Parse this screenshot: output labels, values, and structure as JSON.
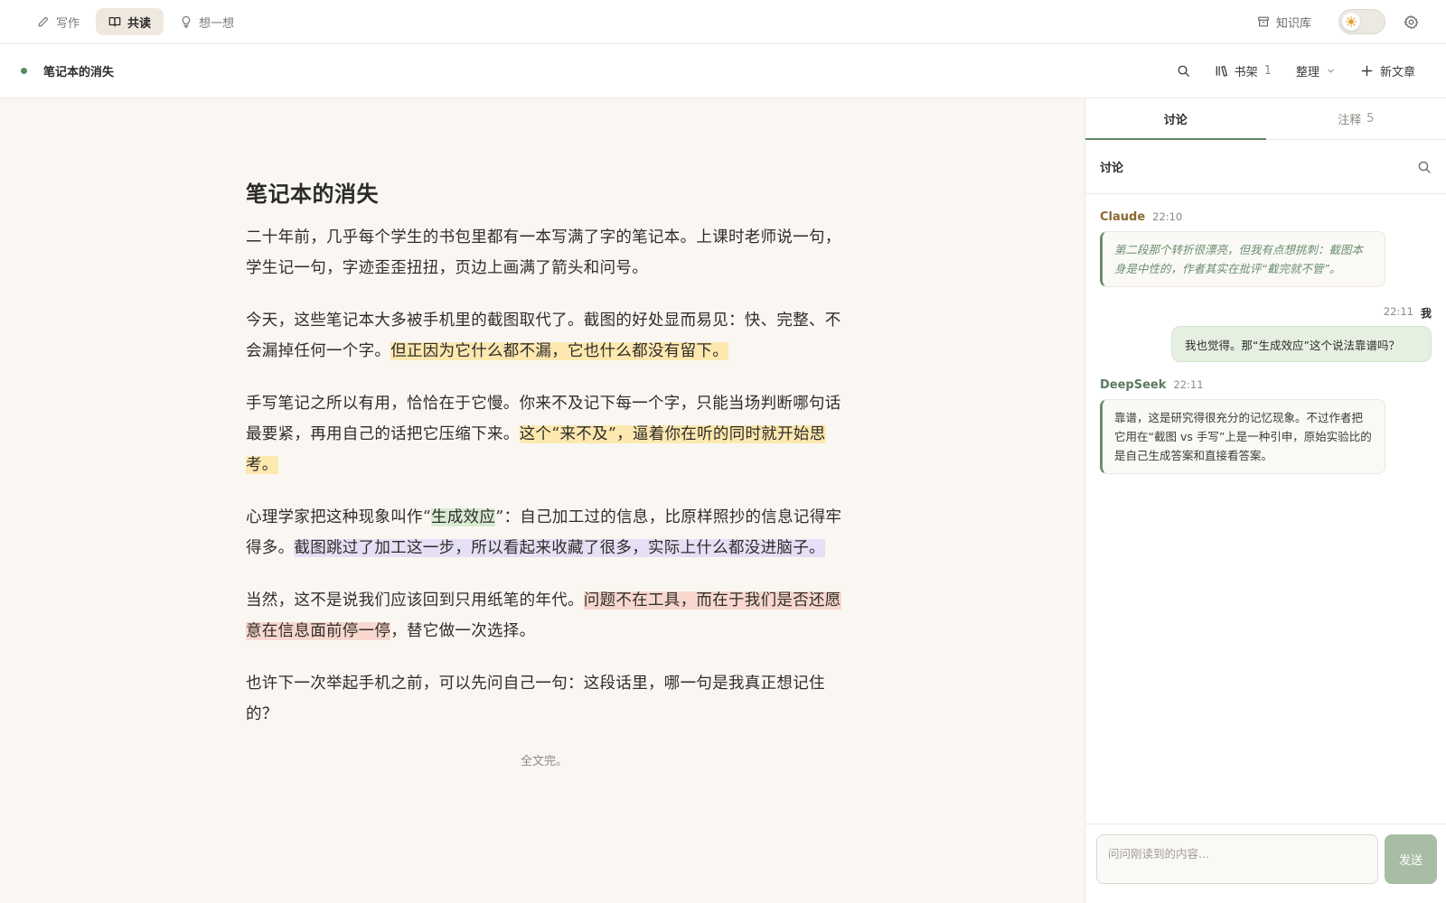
{
  "nav": {
    "modes": [
      {
        "label": "写作",
        "icon": "pencil-icon",
        "active": false
      },
      {
        "label": "共读",
        "icon": "book-open-icon",
        "active": true
      },
      {
        "label": "想一想",
        "icon": "lightbulb-icon",
        "active": false
      }
    ],
    "knowledge_base": "知识库",
    "theme": "light"
  },
  "docbar": {
    "title": "笔记本的消失",
    "bookshelf_label": "书架",
    "bookshelf_count": "1",
    "organize_label": "整理",
    "new_article_label": "新文章"
  },
  "article": {
    "title": "笔记本的消失",
    "p1": "二十年前，几乎每个学生的书包里都有一本写满了字的笔记本。上课时老师说一句，学生记一句，字迹歪歪扭扭，页边上画满了箭头和问号。",
    "p2_a": "今天，这些笔记本大多被手机里的截图取代了。截图的好处显而易见：快、完整、不会漏掉任何一个字。",
    "p2_hl": "但正因为它什么都不漏，它也什么都没有留下。",
    "p3_a": "手写笔记之所以有用，恰恰在于它慢。你来不及记下每一个字，只能当场判断哪句话最要紧，再用自己的话把它压缩下来。",
    "p3_hl": "这个“来不及”，逼着你在听的同时就开始思考。",
    "p4_a": "心理学家把这种现象叫作“",
    "p4_hl1": "生成效应",
    "p4_b": "”：自己加工过的信息，比原样照抄的信息记得牢得多。",
    "p4_hl2": "截图跳过了加工这一步，所以看起来收藏了很多，实际上什么都没进脑子。",
    "p5_a": "当然，这不是说我们应该回到只用纸笔的年代。",
    "p5_hl": "问题不在工具，而在于我们是否还愿意在信息面前停一停",
    "p5_b": "，替它做一次选择。",
    "p6": "也许下一次举起手机之前，可以先问自己一句：这段话里，哪一句是我真正想记住的？",
    "end": "全文完。"
  },
  "panel": {
    "tabs": [
      {
        "label": "讨论",
        "count": ""
      },
      {
        "label": "注释",
        "count": "5"
      }
    ],
    "section_title": "讨论",
    "messages": [
      {
        "author": "Claude",
        "time": "22:10",
        "text": "第二段那个转折很漂亮，但我有点想挑刺：截图本身是中性的，作者其实在批评“截完就不管”。",
        "author_color": "#8a6a2e"
      },
      {
        "author": "我",
        "time": "22:11",
        "text": "我也觉得。那“生成效应”这个说法靠谱吗？"
      },
      {
        "author": "DeepSeek",
        "time": "22:11",
        "text": "靠谱，这是研究得很充分的记忆现象。不过作者把它用在“截图 vs 手写”上是一种引申，原始实验比的是自己生成答案和直接看答案。",
        "author_color": "#5a7a5e"
      }
    ],
    "composer_placeholder": "问问刚读到的内容...",
    "send_label": "发送"
  },
  "colors": {
    "accent": "#5a8a62",
    "highlight_yellow": "#fde8b0",
    "highlight_green": "#d8ecd2",
    "highlight_purple": "#e6e0f6",
    "highlight_red": "#f8d8ce"
  }
}
